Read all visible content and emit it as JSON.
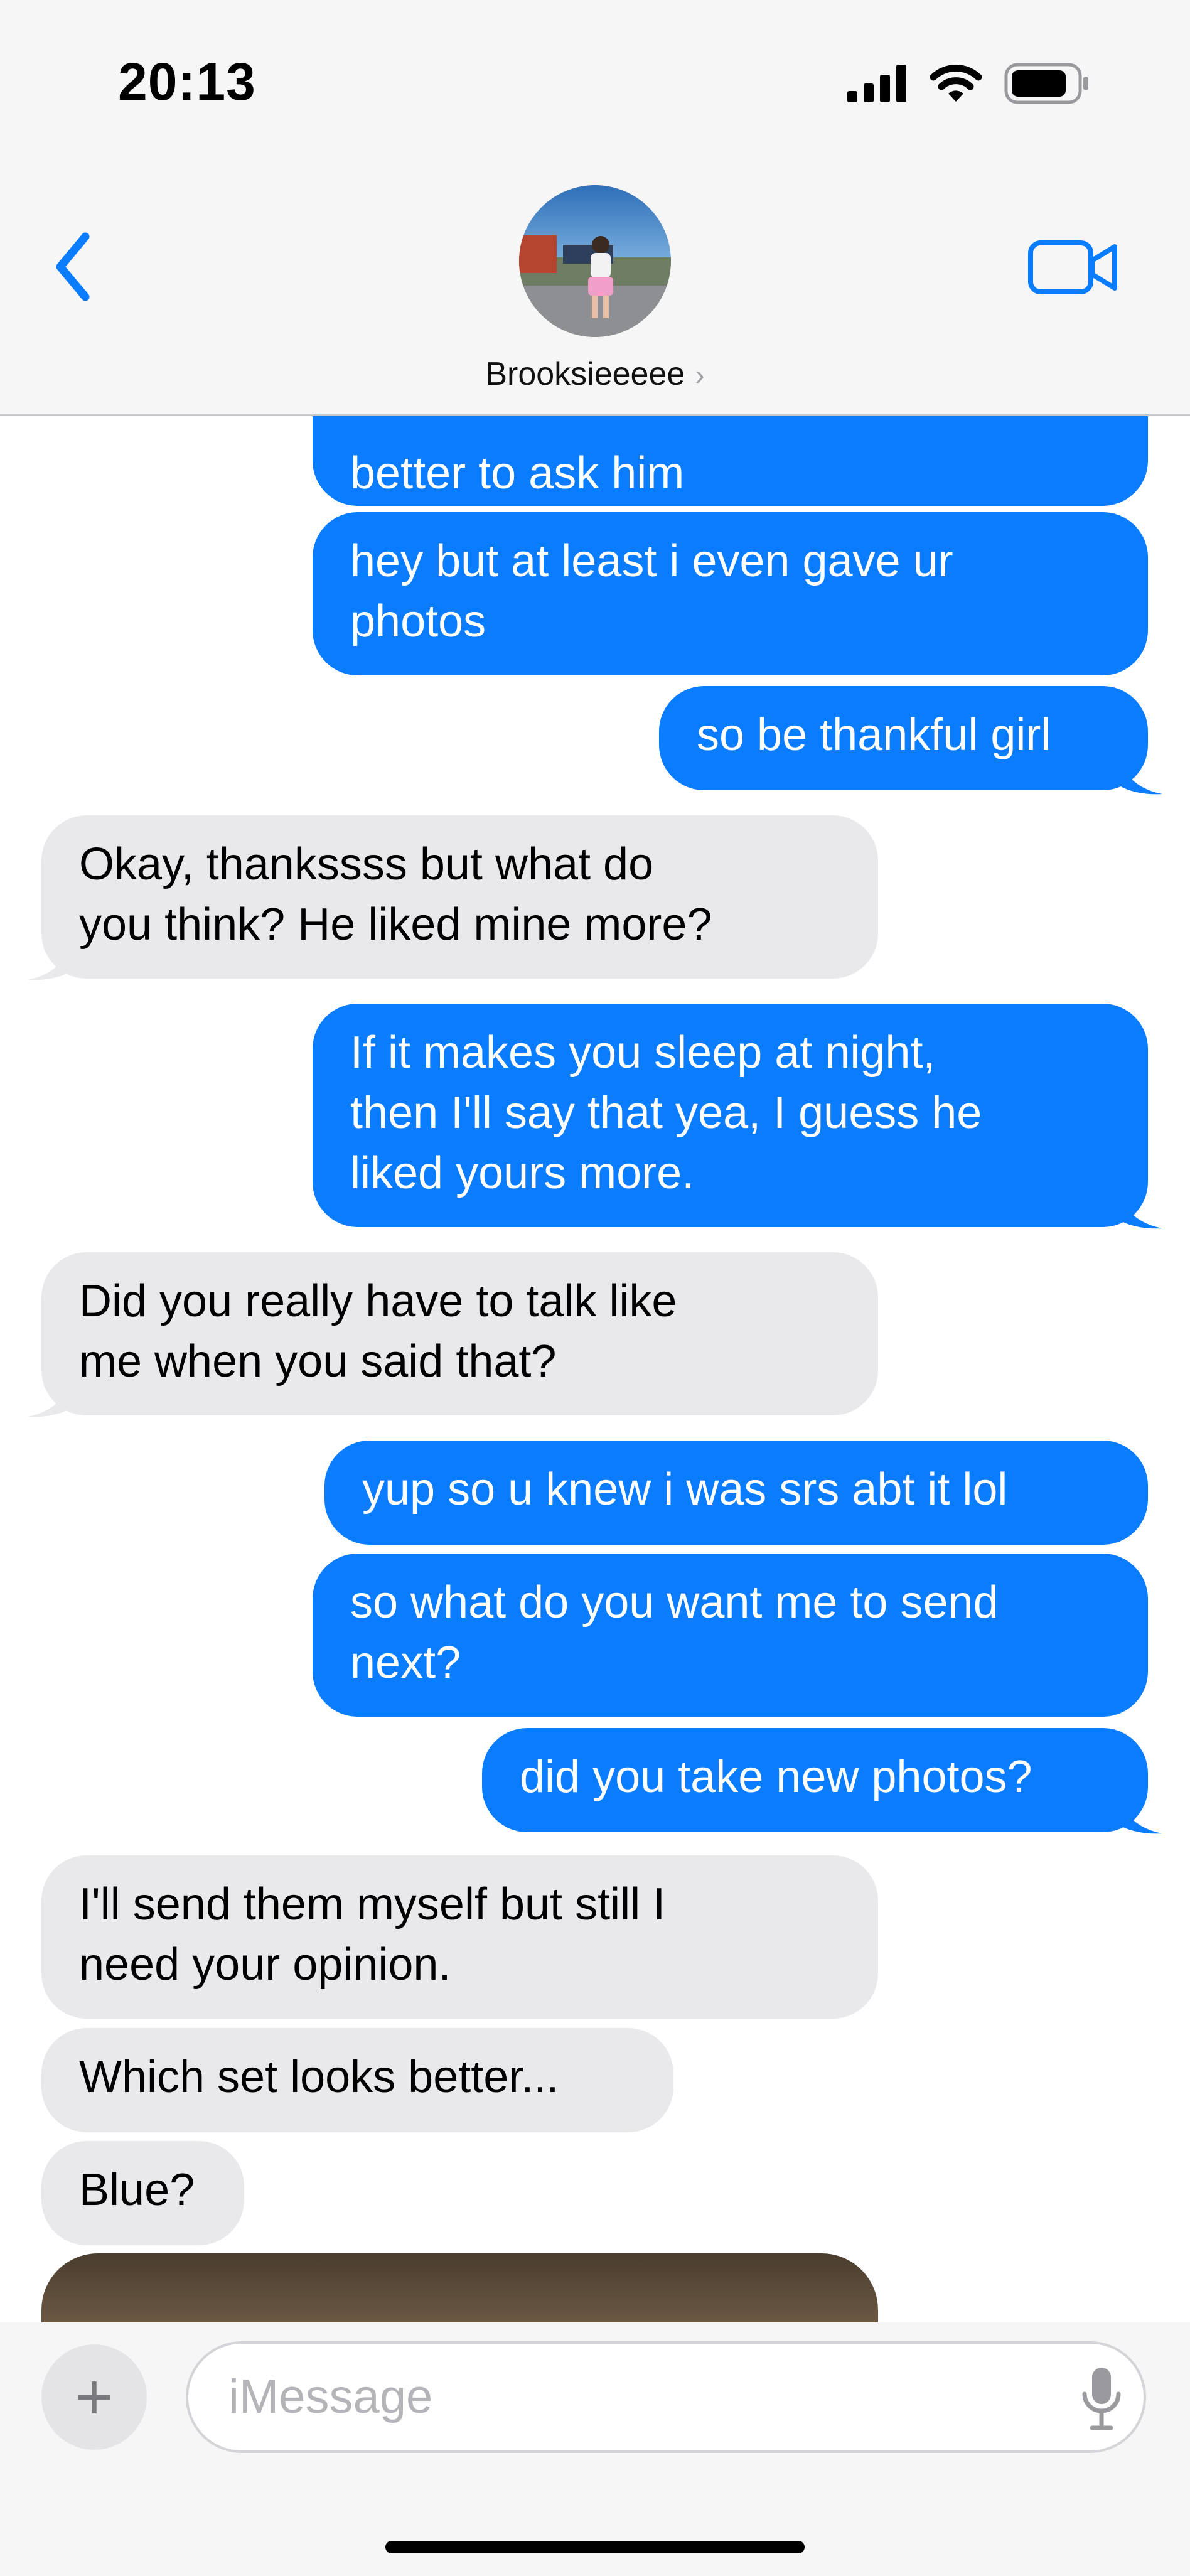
{
  "status": {
    "time": "20:13"
  },
  "header": {
    "contact_name": "Brooksieeeee",
    "chevron": "›"
  },
  "messages": [
    {
      "from": "sent",
      "text": "better to ask him"
    },
    {
      "from": "sent",
      "text": "hey but at least i even gave ur\nphotos"
    },
    {
      "from": "sent",
      "text": "so be thankful girl"
    },
    {
      "from": "received",
      "text": "Okay, thankssss but what do\nyou think? He liked mine more?"
    },
    {
      "from": "sent",
      "text": "If it makes you sleep at night,\nthen I'll say that yea, I guess he\nliked yours more."
    },
    {
      "from": "received",
      "text": "Did you really have to talk like\nme when you said that?"
    },
    {
      "from": "sent",
      "text": "yup so u knew i was srs abt it lol"
    },
    {
      "from": "sent",
      "text": "so what do you want me to send\nnext?"
    },
    {
      "from": "sent",
      "text": "did you take new photos?"
    },
    {
      "from": "received",
      "text": "I'll send them myself but still I\nneed your opinion."
    },
    {
      "from": "received",
      "text": "Which set looks better..."
    },
    {
      "from": "received",
      "text": "Blue?"
    }
  ],
  "composer": {
    "placeholder": "iMessage",
    "plus": "+"
  },
  "colors": {
    "sent": "#0a7cff",
    "received": "#e9e9eb",
    "accent": "#0a7cff"
  },
  "icons": [
    "signal-icon",
    "wifi-icon",
    "battery-icon",
    "back-chevron-icon",
    "video-camera-icon",
    "microphone-icon",
    "plus-icon"
  ]
}
